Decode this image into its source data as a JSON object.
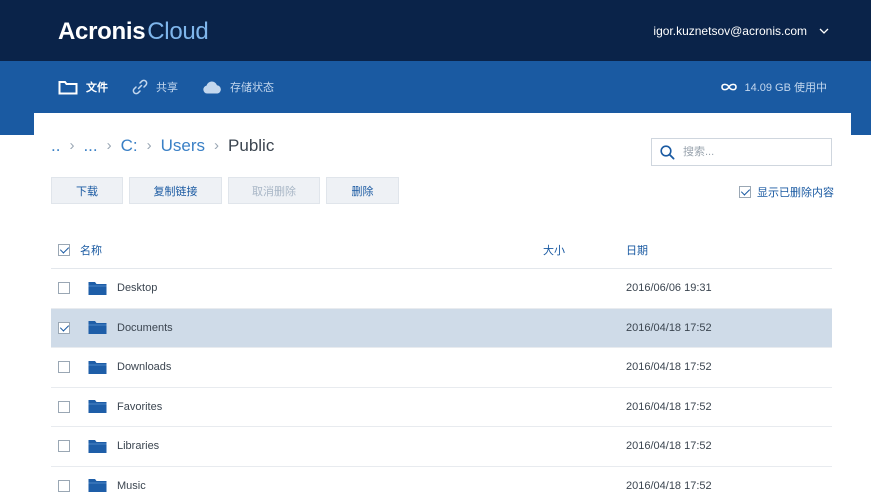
{
  "header": {
    "brand": "Acronis",
    "product": "Cloud",
    "account": "igor.kuznetsov@acronis.com"
  },
  "nav": {
    "items": [
      {
        "label": "文件",
        "icon": "folder-icon",
        "active": true
      },
      {
        "label": "共享",
        "icon": "link-icon",
        "active": false
      },
      {
        "label": "存储状态",
        "icon": "cloud-icon",
        "active": false
      }
    ],
    "storage": "14.09 GB 使用中",
    "storage_icon": "infinity-icon"
  },
  "breadcrumb": [
    {
      "label": ".."
    },
    {
      "label": "..."
    },
    {
      "label": "C:"
    },
    {
      "label": "Users"
    },
    {
      "label": "Public"
    }
  ],
  "search": {
    "placeholder": "搜索..."
  },
  "toolbar": {
    "download": "下载",
    "copy_link": "复制链接",
    "undelete": "取消删除",
    "delete": "删除"
  },
  "show_deleted": {
    "label": "显示已删除内容",
    "checked": true
  },
  "table": {
    "headers": {
      "name": "名称",
      "size": "大小",
      "date": "日期"
    },
    "rows": [
      {
        "name": "Desktop",
        "size": "",
        "date": "2016/06/06 19:31",
        "selected": false
      },
      {
        "name": "Documents",
        "size": "",
        "date": "2016/04/18 17:52",
        "selected": true
      },
      {
        "name": "Downloads",
        "size": "",
        "date": "2016/04/18 17:52",
        "selected": false
      },
      {
        "name": "Favorites",
        "size": "",
        "date": "2016/04/18 17:52",
        "selected": false
      },
      {
        "name": "Libraries",
        "size": "",
        "date": "2016/04/18 17:52",
        "selected": false
      },
      {
        "name": "Music",
        "size": "",
        "date": "2016/04/18 17:52",
        "selected": false
      }
    ]
  },
  "colors": {
    "topbar": "#0a2349",
    "navbar": "#1a5aa2",
    "accent": "#1a5aa2",
    "selected_row": "#cfdbe8"
  }
}
